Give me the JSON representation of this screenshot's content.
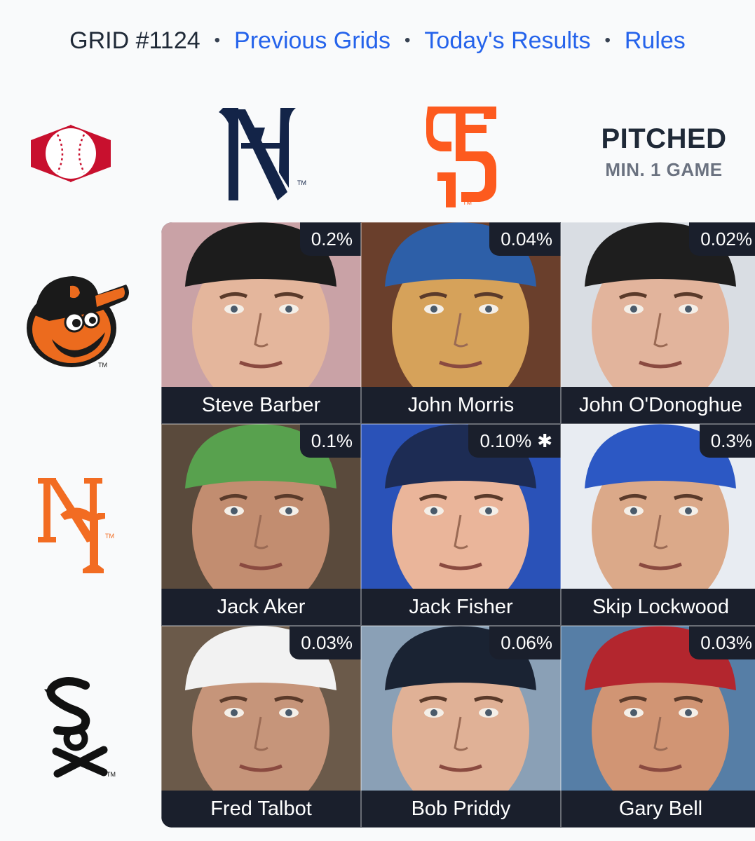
{
  "header": {
    "grid_label": "GRID #1124",
    "separator": "•",
    "links": [
      "Previous Grids",
      "Today's Results",
      "Rules"
    ]
  },
  "columns": [
    {
      "team": "Immaculate Grid",
      "icon": "immaculate-grid-logo-icon"
    },
    {
      "team": "New York Yankees",
      "icon": "yankees-logo-icon",
      "tm": "TM"
    },
    {
      "team": "San Francisco Giants",
      "icon": "giants-logo-icon",
      "tm": "TM"
    }
  ],
  "criteria": {
    "title": "PITCHED",
    "subtitle": "MIN. 1 GAME"
  },
  "rows": [
    {
      "team": "Baltimore Orioles",
      "icon": "orioles-logo-icon",
      "tm": "TM"
    },
    {
      "team": "New York Mets",
      "icon": "mets-logo-icon",
      "tm": "TM"
    },
    {
      "team": "Chicago White Sox",
      "icon": "white-sox-logo-icon",
      "tm": "TM"
    }
  ],
  "cells": [
    {
      "name": "Steve Barber",
      "pct": "0.2%",
      "asterisk": "",
      "cap": "#1c1c1c",
      "skin": "#e4b69c",
      "bg": "#c9a2a6"
    },
    {
      "name": "John Morris",
      "pct": "0.04%",
      "asterisk": "",
      "cap": "#2d5fa8",
      "skin": "#d6a25a",
      "bg": "#6a3f2c"
    },
    {
      "name": "John O'Donoghue",
      "pct": "0.02%",
      "asterisk": "",
      "cap": "#1e1e1e",
      "skin": "#e2b49c",
      "bg": "#d9dde3"
    },
    {
      "name": "Jack Aker",
      "pct": "0.1%",
      "asterisk": "",
      "cap": "#58a14e",
      "skin": "#c28d70",
      "bg": "#5a4a3c"
    },
    {
      "name": "Jack Fisher",
      "pct": "0.10%",
      "asterisk": "✱",
      "cap": "#1d2c54",
      "skin": "#eab59a",
      "bg": "#2a52b8"
    },
    {
      "name": "Skip Lockwood",
      "pct": "0.3%",
      "asterisk": "",
      "cap": "#2c58c4",
      "skin": "#dba989",
      "bg": "#e8ecf2"
    },
    {
      "name": "Fred Talbot",
      "pct": "0.03%",
      "asterisk": "",
      "cap": "#f2f2f2",
      "skin": "#c6957a",
      "bg": "#6b5a4a"
    },
    {
      "name": "Bob Priddy",
      "pct": "0.06%",
      "asterisk": "",
      "cap": "#1a2333",
      "skin": "#e0b196",
      "bg": "#8aa0b6"
    },
    {
      "name": "Gary Bell",
      "pct": "0.03%",
      "asterisk": "",
      "cap": "#b3262e",
      "skin": "#d19574",
      "bg": "#567ea6"
    }
  ],
  "colors": {
    "link": "#2563eb",
    "orioles": "#ec6b1e",
    "mets": "#f26c22",
    "giants": "#fd5a1e",
    "yankees": "#132448",
    "label_bg": "#1a1f2c"
  }
}
